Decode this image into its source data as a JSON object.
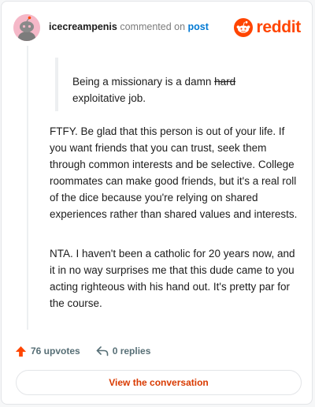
{
  "header": {
    "username": "icecreampenis",
    "action_text": "commented on",
    "post_link": "post",
    "brand_name": "reddit",
    "avatar_icon": "default-snoo-avatar-icon",
    "brand_icon": "reddit-logo-icon"
  },
  "quote": {
    "prefix": "Being a missionary is a damn ",
    "struck": "hard",
    "suffix": " exploitative job."
  },
  "comment": {
    "paragraphs": [
      "FTFY. Be glad that this person is out of your life. If you want friends that you can trust, seek them through common interests and be selective. College roommates can make good friends, but it's a real roll of the dice because you're relying on shared experiences rather than shared values and interests.",
      "NTA. I haven't been a catholic for 20 years now, and it in no way surprises me that this dude came to you acting righteous with his hand out. It's pretty par for the course."
    ]
  },
  "stats": {
    "upvotes": "76 upvotes",
    "replies": "0 replies",
    "upvote_icon": "upvote-arrow-icon",
    "reply_icon": "reply-arrow-icon"
  },
  "actions": {
    "view_conversation": "View the conversation"
  },
  "colors": {
    "brand": "#ff4500",
    "link": "#0079d3",
    "button_text": "#d93a00"
  }
}
